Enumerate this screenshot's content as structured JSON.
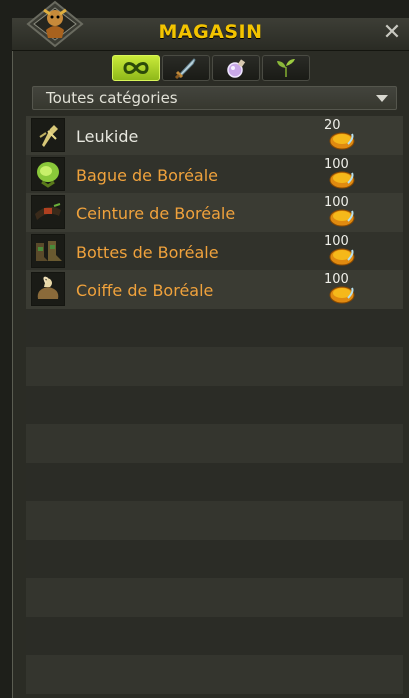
{
  "window": {
    "title": "MAGASIN"
  },
  "tabs": [
    {
      "icon": "infinity-icon",
      "active": true
    },
    {
      "icon": "sword-icon",
      "active": false
    },
    {
      "icon": "potion-icon",
      "active": false
    },
    {
      "icon": "plant-icon",
      "active": false
    }
  ],
  "filter": {
    "selected": "Toutes catégories"
  },
  "items": [
    {
      "name": "Leukide",
      "price": "20",
      "icon": "leukide-icon",
      "name_color": "#e7e7df"
    },
    {
      "name": "Bague de Boréale",
      "price": "100",
      "icon": "ring-icon",
      "name_color": "#f0a23c"
    },
    {
      "name": "Ceinture de Boréale",
      "price": "100",
      "icon": "belt-icon",
      "name_color": "#f0a23c"
    },
    {
      "name": "Bottes de Boréale",
      "price": "100",
      "icon": "boots-icon",
      "name_color": "#f0a23c"
    },
    {
      "name": "Coiffe de Boréale",
      "price": "100",
      "icon": "hat-icon",
      "name_color": "#f0a23c"
    }
  ],
  "colors": {
    "title": "#f3c400",
    "rare_item": "#f0a23c",
    "tab_active": "#b6dd2a"
  }
}
